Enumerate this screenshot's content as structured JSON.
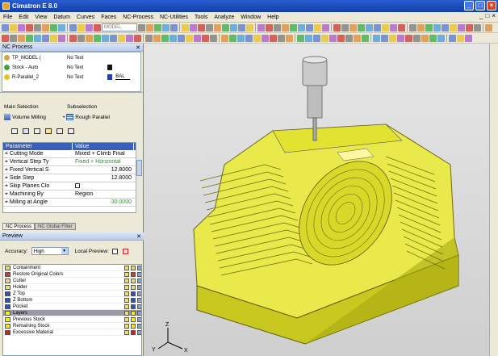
{
  "window": {
    "title": "Cimatron E 8.0",
    "controls": [
      "_",
      "□",
      "×"
    ]
  },
  "menu": {
    "items": [
      "File",
      "Edit",
      "View",
      "Datum",
      "Curves",
      "Faces",
      "NC-Process",
      "NC-Utilities",
      "Tools",
      "Analyze",
      "Window",
      "Help"
    ]
  },
  "toolbar": {
    "model_combo": "MODEL"
  },
  "nc_process": {
    "title": "NC Process",
    "tree": [
      {
        "name": "TP_MODEL (",
        "comment": "No Text",
        "icon": "folder-icon"
      },
      {
        "name": "Stock - Auto",
        "comment": "No Text",
        "icon": "stock-icon"
      },
      {
        "name": "R-Parallel_2",
        "comment": "No Text",
        "extra": "BAL",
        "icon": "toolpath-icon"
      }
    ],
    "main_selection_label": "Main Selection",
    "subselection_label": "Subselection",
    "main_selection_value": "Volume Milling",
    "subselection_value": "Rough Parallel",
    "param_headers": [
      "Parameter",
      "Value"
    ],
    "params": [
      {
        "name": "Cutting Mode",
        "value": "Mixed + Climb Final"
      },
      {
        "name": "Vertical Step Ty",
        "value": "Fixed + Horizontal"
      },
      {
        "name": "Fixed Vertical S",
        "value": "12.8000"
      },
      {
        "name": "Side Step",
        "value": "12.8000"
      },
      {
        "name": "Skip Planes Clo",
        "value": ""
      },
      {
        "name": "Machining By",
        "value": "Region"
      },
      {
        "name": "Milling at Angle",
        "value": "30.0000"
      }
    ],
    "tabs": [
      "NC Process",
      "NC Global Filter"
    ]
  },
  "preview": {
    "title": "Preview",
    "accuracy_label": "Accuracy:",
    "accuracy_value": "High",
    "local_preview_label": "Local Preview:",
    "items": [
      {
        "label": "Containment",
        "color": "#e8d85a"
      },
      {
        "label": "Restore Original Colors",
        "color": "#c04040"
      },
      {
        "label": "Cutter",
        "color": "#e0e080"
      },
      {
        "label": "Holder",
        "color": "#e0e080"
      },
      {
        "label": "Z Top",
        "color": "#3050c0"
      },
      {
        "label": "Z Bottom",
        "color": "#3050c0"
      },
      {
        "label": "Pocket",
        "color": "#3050c0"
      },
      {
        "label": "Layers",
        "color": "#f4f000"
      },
      {
        "label": "Previous Stock",
        "color": "#f4f000"
      },
      {
        "label": "Remaining Stock",
        "color": "#f4f000"
      },
      {
        "label": "Excessive Material",
        "color": "#d02020"
      }
    ]
  },
  "viewport": {
    "axis_labels": [
      "Z",
      "Y",
      "X"
    ],
    "part_color": "#e8e600"
  }
}
